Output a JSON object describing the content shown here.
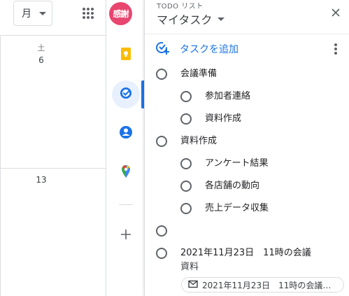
{
  "header": {
    "view_select": "月",
    "avatar_text": "感謝"
  },
  "calendar": {
    "day_name": "土",
    "day_number_1": "6",
    "day_number_2": "13"
  },
  "tasks_panel": {
    "subtitle": "TODO リスト",
    "title": "マイタスク",
    "add_task_label": "タスクを追加",
    "tasks": [
      {
        "text": "会議準備"
      },
      {
        "text": "参加者連絡"
      },
      {
        "text": "資料作成"
      },
      {
        "text": "資料作成"
      },
      {
        "text": "アンケート結果"
      },
      {
        "text": "各店舗の動向"
      },
      {
        "text": "売上データ収集"
      },
      {
        "text": ""
      },
      {
        "text": "2021年11月23日　11時の会議"
      }
    ],
    "task_note": "資料",
    "email_chip": "2021年11月23日　11時の会議…"
  },
  "colors": {
    "accent": "#1a73e8",
    "avatar_bg": "#e8466f",
    "keep_yellow": "#fbbc04",
    "contacts_blue": "#1a73e8"
  },
  "icons": {
    "apps": "apps-grid-icon",
    "keep": "keep-icon",
    "tasks": "tasks-icon",
    "contacts": "contacts-icon",
    "maps": "maps-icon",
    "add": "plus-icon",
    "close": "close-icon",
    "more": "more-vert-icon",
    "mail": "mail-icon"
  }
}
